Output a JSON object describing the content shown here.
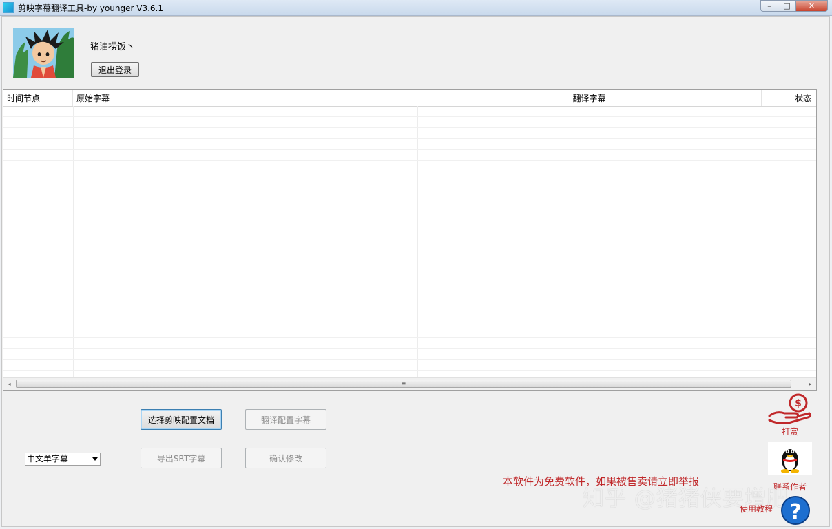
{
  "window": {
    "title": "剪映字幕翻译工具-by younger  V3.6.1",
    "min_glyph": "–",
    "max_glyph": "□",
    "close_glyph": "✕"
  },
  "user": {
    "name": "猪油捞饭丶",
    "logout_label": "退出登录"
  },
  "table": {
    "columns": [
      "时间节点",
      "原始字幕",
      "翻译字幕",
      "状态"
    ],
    "rows": [],
    "scroll_left_glyph": "◂",
    "scroll_right_glyph": "▸",
    "scroll_thumb_glyph": "≡"
  },
  "actions": {
    "select_config": "选择剪映配置文档",
    "translate": "翻译配置字幕",
    "export_srt": "导出SRT字幕",
    "confirm_edit": "确认修改"
  },
  "subtitle_mode": {
    "selected": "中文单字幕"
  },
  "notice": "本软件为免费软件，如果被售卖请立即举报",
  "side": {
    "tip_label": "打赏",
    "contact_label": "联系作者",
    "help_label": "使用教程"
  },
  "watermark": "知乎 @猪猪侠要增肥",
  "colors": {
    "accent_red": "#c0282a",
    "grid_border": "#a0a0a0",
    "window_bg": "#f0f0f0"
  },
  "icons": [
    "app-icon",
    "avatar",
    "money-hand-icon",
    "qq-penguin-icon",
    "help-question-icon"
  ]
}
